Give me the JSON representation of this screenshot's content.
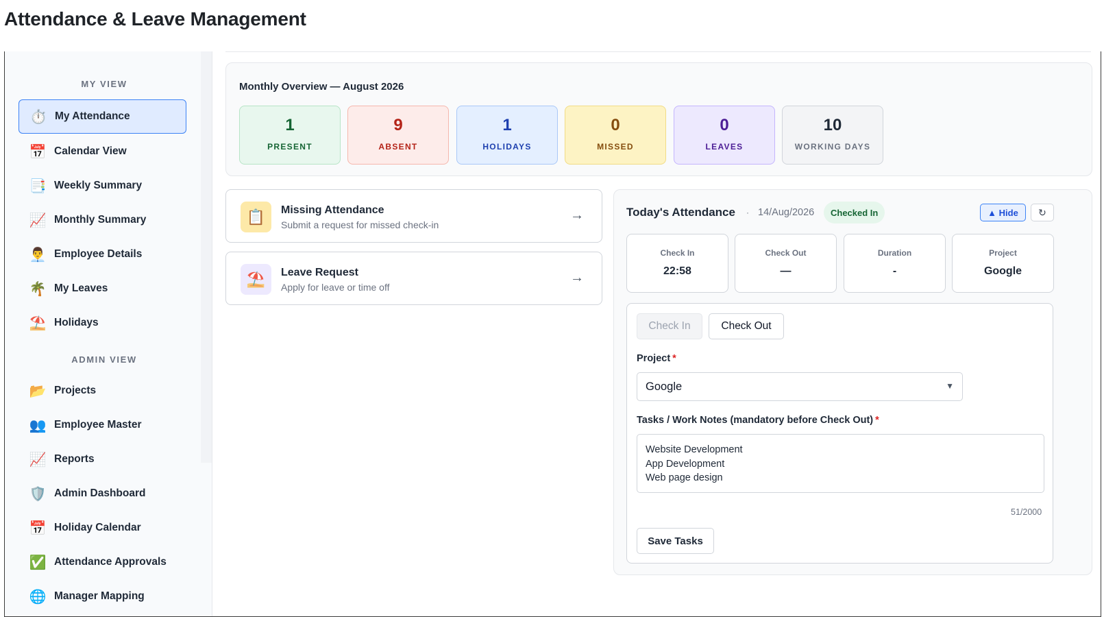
{
  "page_title": "Attendance & Leave Management",
  "sidebar": {
    "section_my": "MY VIEW",
    "section_admin": "ADMIN VIEW",
    "items": [
      {
        "label": "My Attendance",
        "icon": "⏱️"
      },
      {
        "label": "Calendar View",
        "icon": "📅"
      },
      {
        "label": "Weekly Summary",
        "icon": "📑"
      },
      {
        "label": "Monthly Summary",
        "icon": "📈"
      },
      {
        "label": "Employee Details",
        "icon": "👨‍💼"
      },
      {
        "label": "My Leaves",
        "icon": "🌴"
      },
      {
        "label": "Holidays",
        "icon": "⛱️"
      },
      {
        "label": "Projects",
        "icon": "📂"
      },
      {
        "label": "Employee Master",
        "icon": "👥"
      },
      {
        "label": "Reports",
        "icon": "📈"
      },
      {
        "label": "Admin Dashboard",
        "icon": "🛡️"
      },
      {
        "label": "Holiday Calendar",
        "icon": "📅"
      },
      {
        "label": "Attendance Approvals",
        "icon": "✅"
      },
      {
        "label": "Manager Mapping",
        "icon": "🌐"
      }
    ]
  },
  "overview": {
    "title": "Monthly Overview — August 2026",
    "stats": [
      {
        "value": "1",
        "label": "PRESENT"
      },
      {
        "value": "9",
        "label": "ABSENT"
      },
      {
        "value": "1",
        "label": "HOLIDAYS"
      },
      {
        "value": "0",
        "label": "MISSED"
      },
      {
        "value": "0",
        "label": "LEAVES"
      },
      {
        "value": "10",
        "label": "WORKING DAYS"
      }
    ]
  },
  "cards": [
    {
      "title": "Missing Attendance",
      "subtitle": "Submit a request for missed check-in",
      "icon": "📋",
      "arrow": "→"
    },
    {
      "title": "Leave Request",
      "subtitle": "Apply for leave or time off",
      "icon": "⛱️",
      "arrow": "→"
    }
  ],
  "today": {
    "title": "Today's Attendance",
    "separator": "·",
    "date": "14/Aug/2026",
    "status": "Checked In",
    "hide_label": "▲ Hide",
    "refresh_icon": "↻",
    "info": [
      {
        "label": "Check In",
        "value": "22:58"
      },
      {
        "label": "Check Out",
        "value": "—"
      },
      {
        "label": "Duration",
        "value": "-"
      },
      {
        "label": "Project",
        "value": "Google"
      }
    ],
    "check_in_label": "Check In",
    "check_out_label": "Check Out",
    "project_label": "Project",
    "required_mark": "*",
    "project_value": "Google",
    "tasks_label": "Tasks / Work Notes (mandatory before Check Out)",
    "tasks_lines": [
      "Website Development",
      "App Development",
      "Web page design"
    ],
    "counter": "51/2000",
    "save_label": "Save Tasks"
  }
}
